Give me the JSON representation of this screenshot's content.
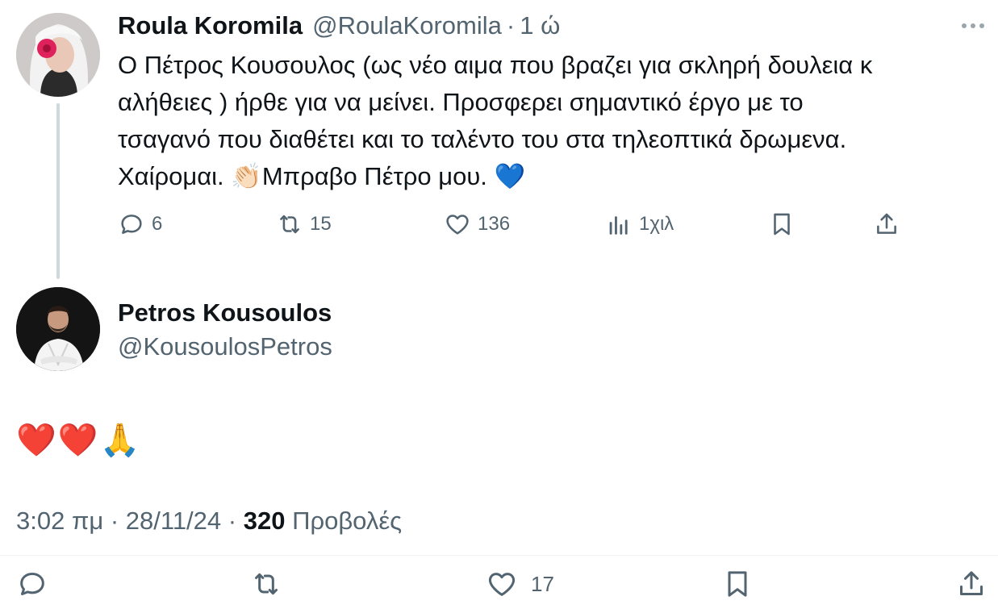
{
  "parent_tweet": {
    "author_name": "Roula Koromila",
    "author_handle": "@RoulaKoromila",
    "separator": "·",
    "time": "1 ώ",
    "text_lines": [
      "Ο Πέτρος Κουσουλος (ως νέο αιμα που βραζει για σκληρή δουλεια κ",
      "αλήθειες ) ήρθε για να μείνει. Προσφερει σημαντικό έργο με το",
      "τσαγανό που διαθέτει και το ταλέντο του στα τηλεοπτικά δρωμενα.",
      "Χαίρομαι. 👏🏻Μπραβο Πέτρο μου. 💙"
    ],
    "stats": {
      "replies": "6",
      "reposts": "15",
      "likes": "136",
      "views": "1χιλ"
    }
  },
  "reply_tweet": {
    "author_name": "Petros Kousoulos",
    "author_handle": "@KousoulosPetros",
    "text": "❤️❤️🙏",
    "time": "3:02 πμ",
    "date": "28/11/24",
    "separator": "·",
    "views_count": "320",
    "views_label": "Προβολές",
    "stats": {
      "likes": "17"
    }
  },
  "icons": {
    "reply": "reply-icon",
    "repost": "repost-icon",
    "like": "heart-icon",
    "views": "analytics-icon",
    "bookmark": "bookmark-icon",
    "share": "share-icon",
    "more": "more-icon"
  },
  "colors": {
    "text_primary": "#0f1419",
    "text_secondary": "#536471",
    "thread_line": "#cfd9de"
  }
}
